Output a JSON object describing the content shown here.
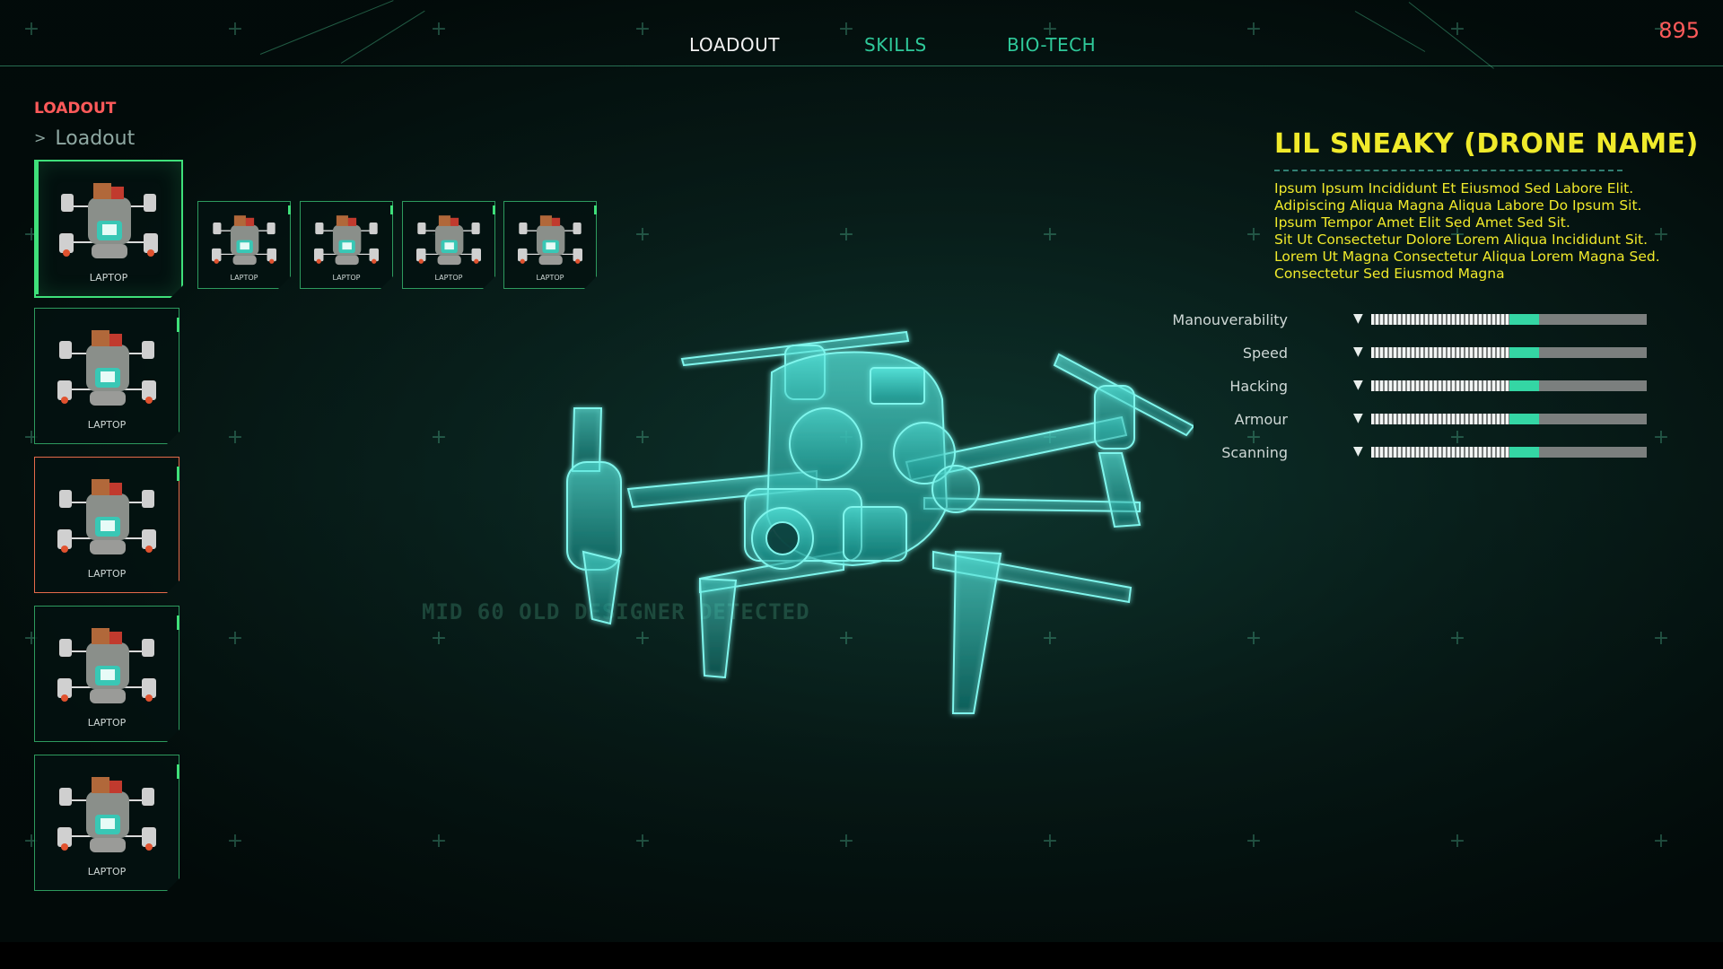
{
  "header": {
    "tabs": [
      {
        "label": "LOADOUT",
        "active": true
      },
      {
        "label": "SKILLS",
        "active": false
      },
      {
        "label": "BIO-TECH",
        "active": false
      }
    ],
    "credits": "895"
  },
  "sidebar": {
    "section_title": "LOADOUT",
    "breadcrumb_sep": ">",
    "breadcrumb": "Loadout",
    "slots": [
      {
        "label": "LAPTOP",
        "selected": true
      },
      {
        "label": "LAPTOP"
      },
      {
        "label": "LAPTOP"
      },
      {
        "label": "LAPTOP"
      },
      {
        "label": "LAPTOP"
      }
    ],
    "options": [
      {
        "label": "LAPTOP"
      },
      {
        "label": "LAPTOP"
      },
      {
        "label": "LAPTOP"
      },
      {
        "label": "LAPTOP"
      }
    ]
  },
  "details": {
    "title": "LIL SNEAKY (DRONE NAME)",
    "description": [
      "Ipsum Ipsum Incididunt Et Eiusmod Sed Labore Elit.",
      "Adipiscing Aliqua Magna Aliqua Labore Do Ipsum Sit.",
      "Ipsum Tempor Amet Elit Sed Amet Sed Sit.",
      "Sit Ut Consectetur Dolore Lorem Aliqua Incididunt Sit.",
      "Lorem Ut Magna Consectetur Aliqua Lorem Magna Sed.",
      "Consectetur Sed Eiusmod Magna"
    ],
    "stats": [
      {
        "label": "Manouverability",
        "value": 0.5,
        "boost": 0.11
      },
      {
        "label": "Speed",
        "value": 0.5,
        "boost": 0.11
      },
      {
        "label": "Hacking",
        "value": 0.5,
        "boost": 0.11
      },
      {
        "label": "Armour",
        "value": 0.5,
        "boost": 0.11
      },
      {
        "label": "Scanning",
        "value": 0.5,
        "boost": 0.11
      }
    ]
  },
  "background_text": "MID 60 OLD DESIGNER DETECTED",
  "colors": {
    "accent_green": "#2fc99a",
    "alert_red": "#ff5a5a",
    "title_yellow": "#f0ea2b",
    "hologram_cyan": "#2fd2c8"
  },
  "icons": [
    "dropdown-arrow-icon",
    "drone-icon"
  ]
}
